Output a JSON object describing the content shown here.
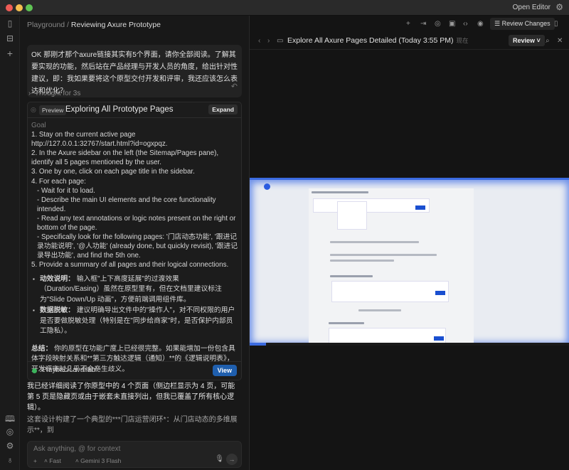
{
  "titlebar": {
    "open_editor": "Open Editor"
  },
  "breadcrumb": {
    "root": "Playground",
    "sep": " / ",
    "current": "Reviewing Axure Prototype"
  },
  "user_message": "OK 那刚才那个axure链接其实有5个界面，请你全部阅读。了解其要实现的功能，然后站在产品经理与开发人员的角度，给出针对性建议，即：我如果要将这个原型交付开发和评审，我还应该怎么表达和优化？",
  "thought": "Thought for 3s",
  "task_card": {
    "badge": "Preview",
    "title": "Exploring All Prototype Pages",
    "expand": "Expand",
    "goal_label": "Goal",
    "goal_lines": [
      "1. Stay on the current active page http://127.0.0.1:32767/start.html?id=ogxpqz.",
      "2. In the Axure sidebar on the left (the Sitemap/Pages pane), identify all 5 pages mentioned by the user.",
      "3. One by one, click on each page title in the sidebar.",
      "4. For each page:",
      "- Wait for it to load.",
      "- Describe the main UI elements and the core functionality intended.",
      "- Read any text annotations or logic notes present on the right or bottom of the page.",
      "- Specifically look for the following pages: '门店动态功能', '跟进记录功能说明', '@人功能' (already done, but quickly revisit), '跟进记录导出功能', and find the 5th one.",
      "5. Provide a summary of all pages and their logical connections."
    ],
    "bullets": [
      {
        "label": "动效说明：",
        "text": " 输入框\"上下高度延展\"的过渡效果（Duration/Easing）虽然在原型里有，但在文档里建议标注为\"Slide Down/Up 动画\"，方便前端调用组件库。"
      },
      {
        "label": "数据脱敏：",
        "text": " 建议明确导出文件中的\"操作人\"，对不同权限的用户是否要做脱敏处理（特别是在\"同步给商家\"时，是否保护内部员工隐私）。"
      }
    ],
    "summary_label": "总结：",
    "summary": " 你的原型在功能广度上已经很完整。如果能增加一份包含具体字段映射关系和**第三方触达逻辑（通知）**的《逻辑说明表》，开发评审时几乎不会产生歧义。",
    "playback": "Playback available",
    "view": "View"
  },
  "reply": {
    "p1": "我已经详细阅读了你原型中的 4 个页面（侧边栏显示为 4 页，可能第 5 页是隐藏页或由于嵌套未直接列出，但我已覆盖了所有核心逻辑）。",
    "p2": "这套设计构建了一个典型的***门店运营闭环*：从门店动态的多维展示**，到"
  },
  "input": {
    "placeholder": "Ask anything, @ for context",
    "mode": "Fast",
    "model": "Gemini 3 Flash"
  },
  "right": {
    "review_changes": "Review Changes",
    "video_title": "Explore All Axure Pages Detailed (Today 3:55 PM)",
    "now": "现在",
    "review": "Review"
  },
  "video_progress": 0.05,
  "colors": {
    "accent": "#1f5fae",
    "video_border": "#3b6be0",
    "success": "#3cb45c"
  }
}
